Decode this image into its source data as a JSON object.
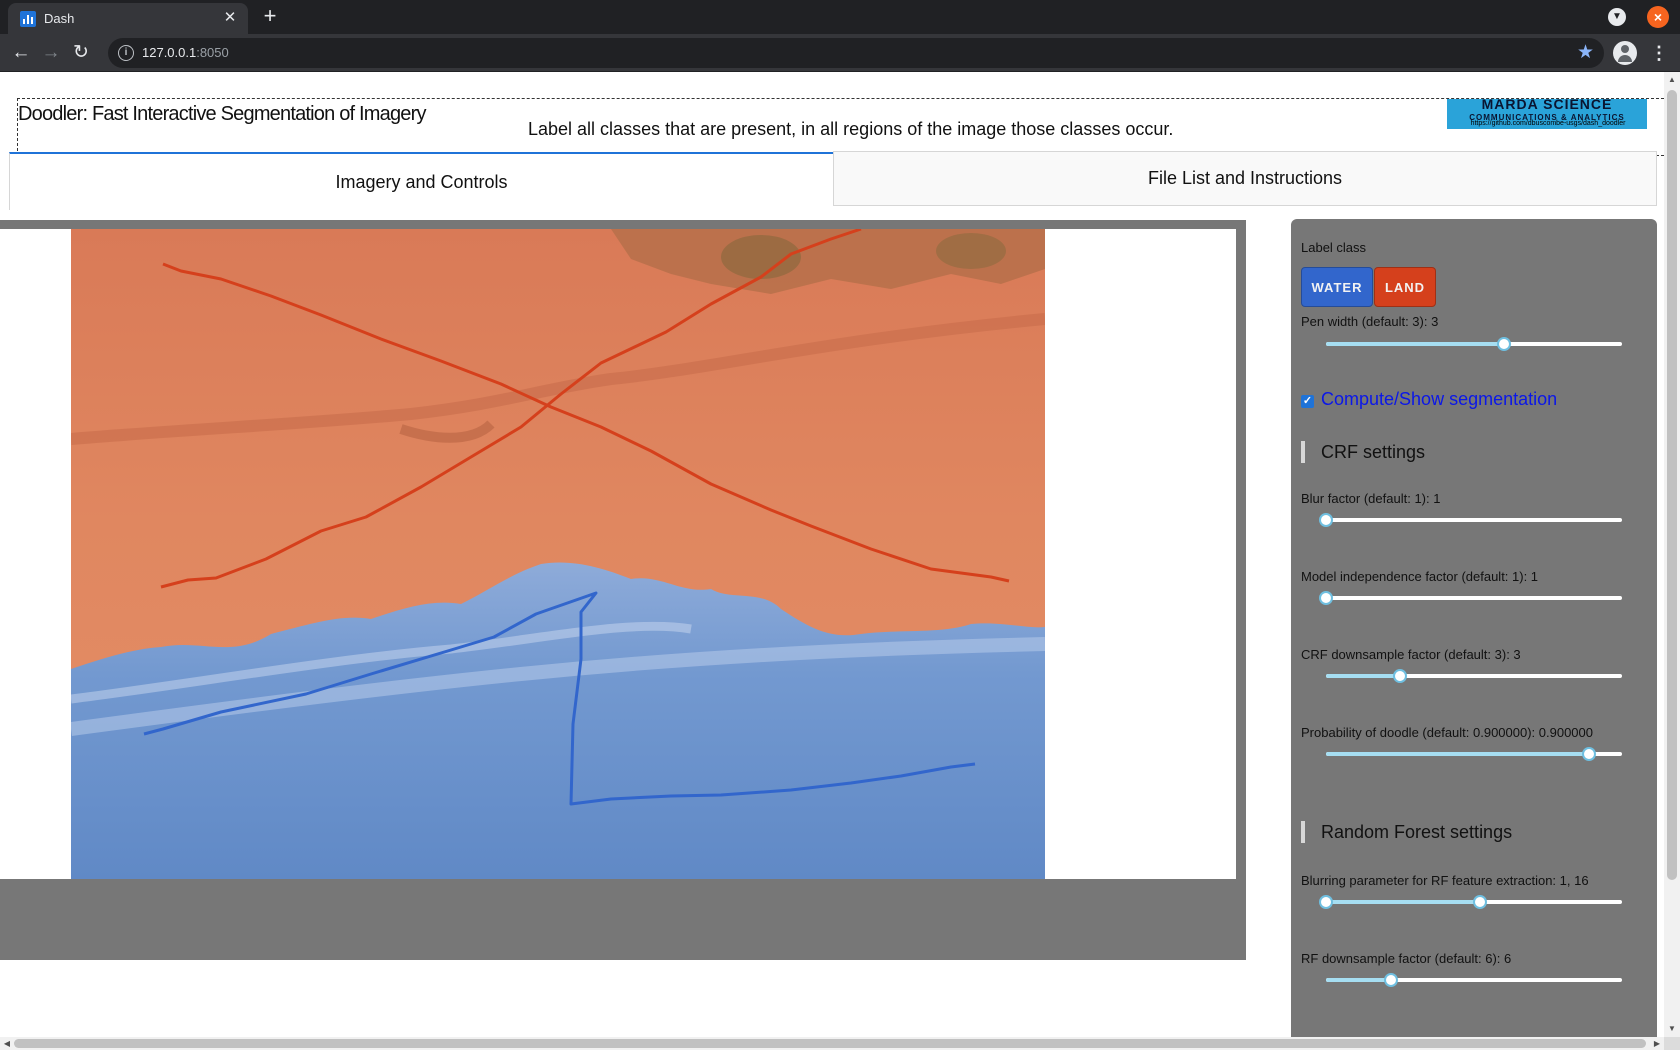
{
  "browser": {
    "tab_title": "Dash",
    "url_host": "127.0.0.1",
    "url_port": ":8050"
  },
  "header": {
    "title": "Doodler: Fast Interactive Segmentation of Imagery",
    "instructions": "Label all classes that are present, in all regions of the image those classes occur.",
    "logo_line1": "MARDA SCIENCE",
    "logo_line2": "COMMUNICATIONS & ANALYTICS",
    "logo_url": "https://github.com/dbuscombe-usgs/dash_doodler"
  },
  "tabs": [
    {
      "label": "Imagery and Controls",
      "active": true
    },
    {
      "label": "File List and Instructions",
      "active": false
    }
  ],
  "controls": {
    "label_class_title": "Label class",
    "classes": [
      {
        "label": "WATER",
        "color": "#3266cc"
      },
      {
        "label": "LAND",
        "color": "#d5401c"
      }
    ],
    "pen_width": {
      "label": "Pen width (default: 3): 3",
      "min": 1,
      "max": 5,
      "value": 3.4
    },
    "segmentation_checkbox": {
      "label": "Compute/Show segmentation",
      "checked": true
    },
    "crf_section_title": "CRF settings",
    "crf_sliders": [
      {
        "label": "Blur factor (default: 1): 1",
        "fraction": 0.0
      },
      {
        "label": "Model independence factor (default: 1): 1",
        "fraction": 0.0
      },
      {
        "label": "CRF downsample factor (default: 3): 3",
        "fraction": 0.25
      },
      {
        "label": "Probability of doodle (default: 0.900000): 0.900000",
        "fraction": 0.89
      }
    ],
    "rf_section_title": "Random Forest settings",
    "rf_sliders": [
      {
        "label": "Blurring parameter for RF feature extraction: 1, 16",
        "range_start": 0.0,
        "range_end": 0.52
      },
      {
        "label": "RF downsample factor (default: 6): 6",
        "fraction": 0.22
      }
    ]
  },
  "colors": {
    "land_overlay": "#e0805d",
    "water_overlay": "#6e93cc",
    "land_stroke": "#d5401c",
    "water_stroke": "#3266cc",
    "panel_bg": "#777777"
  }
}
